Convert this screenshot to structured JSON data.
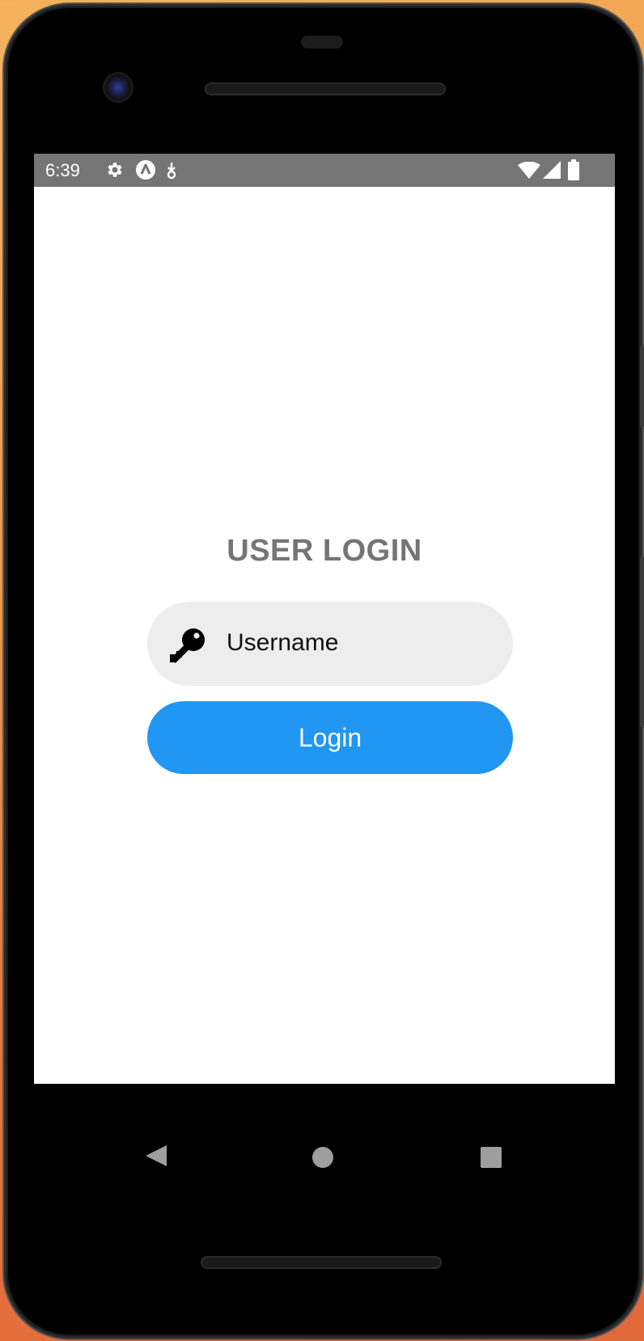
{
  "status_bar": {
    "time": "6:39",
    "left_icons": [
      "gear-icon",
      "app-a-icon",
      "download-icon"
    ],
    "right_icons": [
      "wifi-icon",
      "signal-icon",
      "battery-icon"
    ],
    "background": "#757575"
  },
  "login": {
    "title": "USER LOGIN",
    "username_placeholder": "Username",
    "key_icon": "key-icon",
    "button_label": "Login",
    "accent_color": "#2196f3",
    "input_background": "#ededed"
  },
  "nav_bar": {
    "items": [
      "back-icon",
      "home-icon",
      "recents-icon"
    ]
  }
}
